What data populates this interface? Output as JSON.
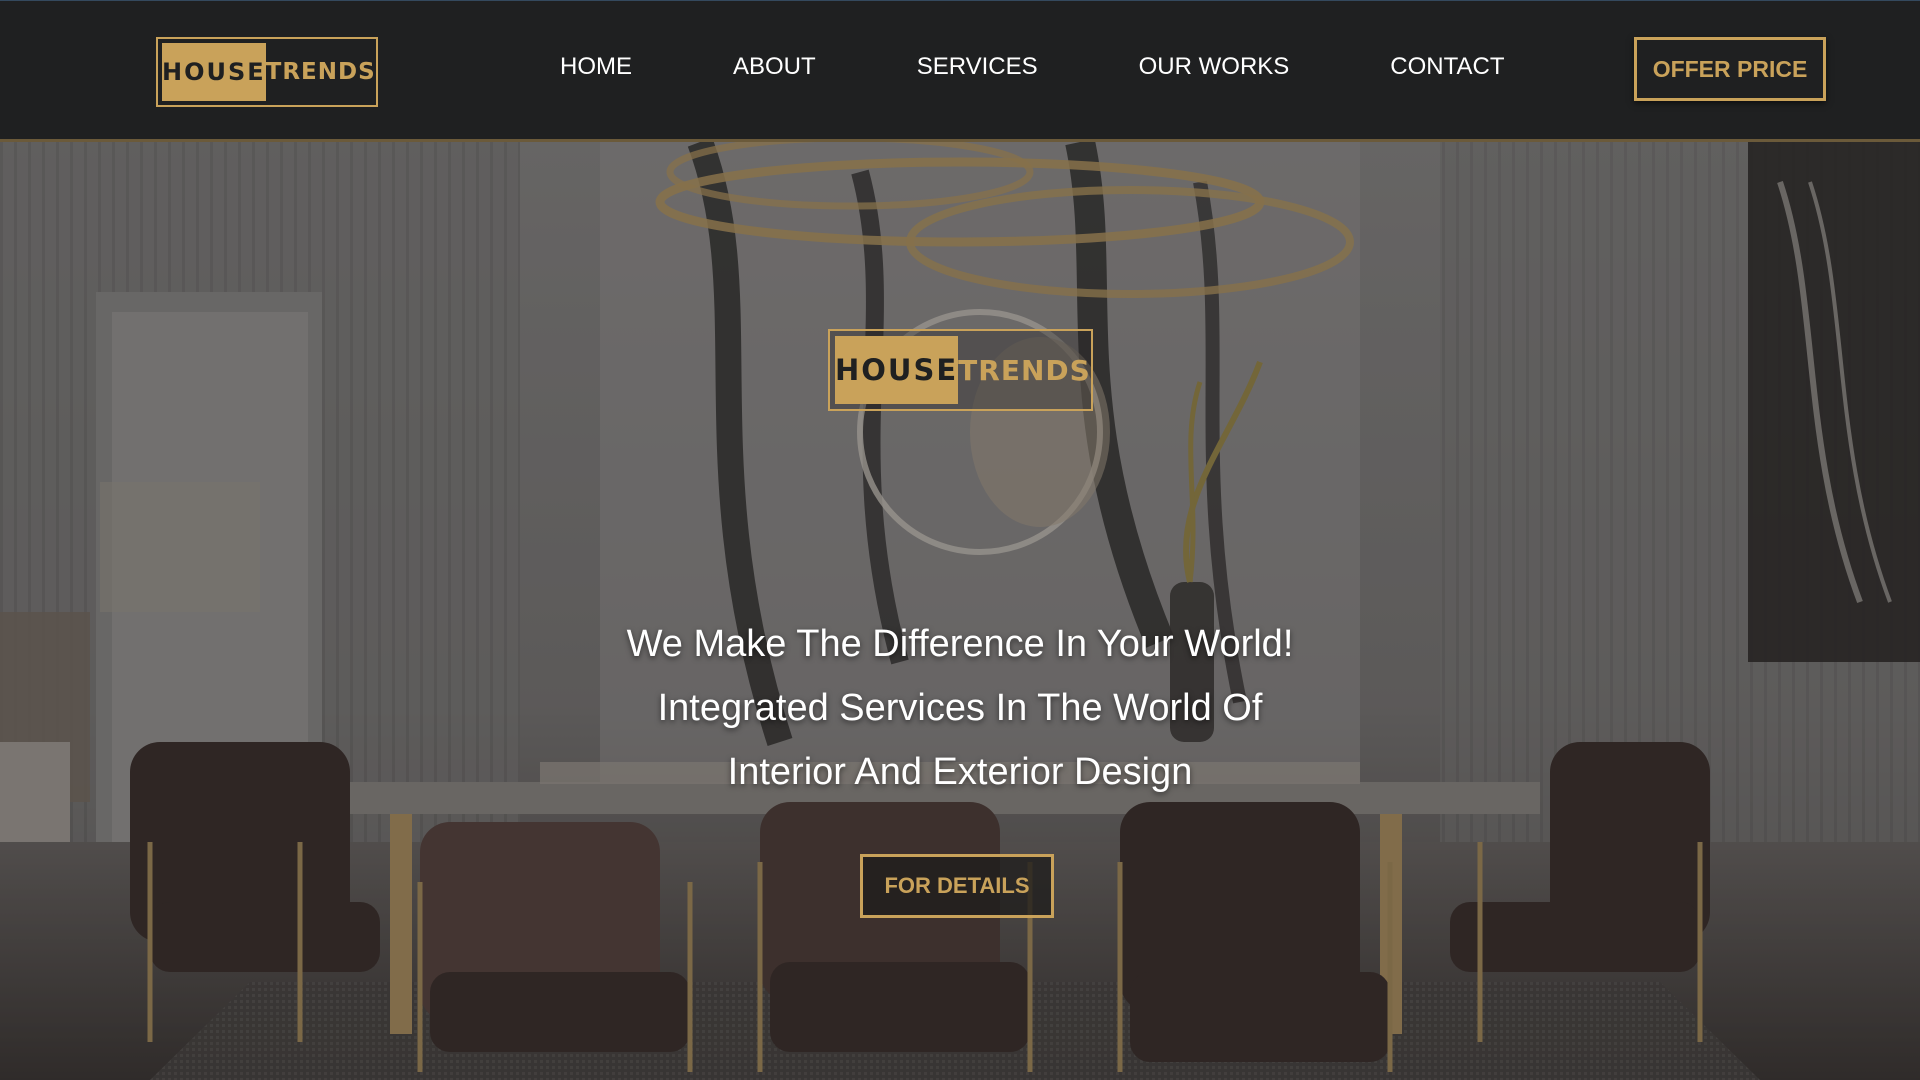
{
  "brand": {
    "logo_word_1": "HOUSE",
    "logo_word_2": "TRENDS"
  },
  "nav": {
    "items": [
      {
        "label": "HOME"
      },
      {
        "label": "ABOUT"
      },
      {
        "label": "SERVICES"
      },
      {
        "label": "OUR WORKS"
      },
      {
        "label": "CONTACT"
      }
    ]
  },
  "header": {
    "offer_label": "OFFER PRICE"
  },
  "hero": {
    "tagline_lines": [
      "We Make The Difference In Your World!",
      "Integrated Services In The World Of",
      "Interior And Exterior Design"
    ],
    "details_label": "FOR DETAILS"
  },
  "colors": {
    "accent_gold": "#c9a25a",
    "header_bg": "#1f2021",
    "nav_text": "#ffffff"
  }
}
